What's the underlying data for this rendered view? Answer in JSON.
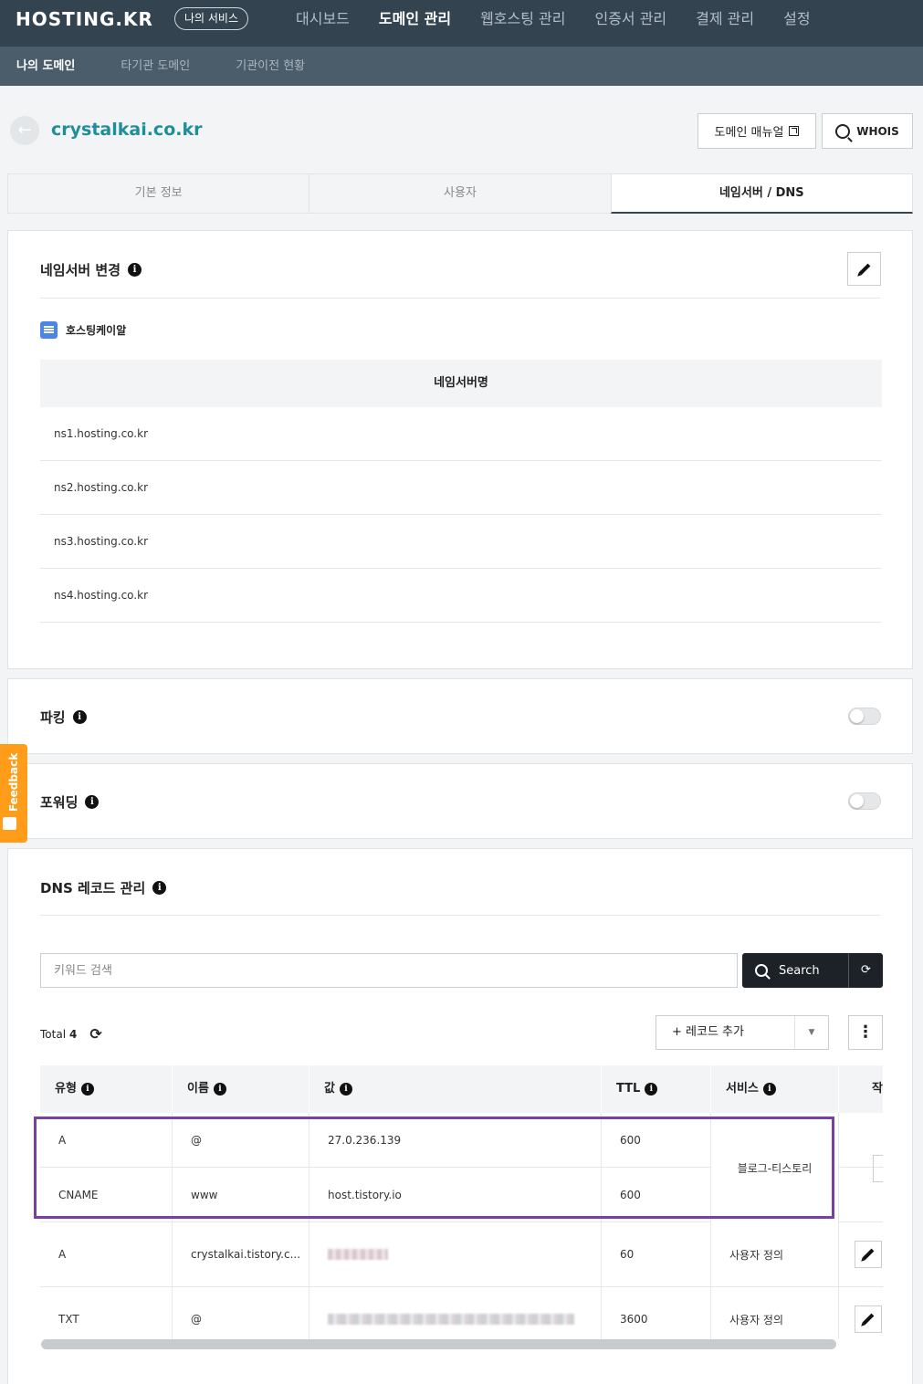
{
  "brand": {
    "logo": "HOSTING.KR",
    "my_service": "나의 서비스"
  },
  "main_nav": [
    "대시보드",
    "도메인 관리",
    "웹호스팅 관리",
    "인증서 관리",
    "결제 관리",
    "설정"
  ],
  "main_nav_active": "도메인 관리",
  "sub_nav": [
    "나의 도메인",
    "타기관 도메인",
    "기관이전 현황"
  ],
  "sub_nav_active": "나의 도메인",
  "header": {
    "domain": "crystalkai.co.kr",
    "manual_label": "도메인 매뉴얼",
    "whois_label": "WHOIS"
  },
  "tabs": [
    "기본 정보",
    "사용자",
    "네임서버 / DNS"
  ],
  "tab_active": "네임서버 / DNS",
  "nameserver": {
    "title": "네임서버 변경",
    "provider": "호스팅케이알",
    "column": "네임서버명",
    "servers": [
      "ns1.hosting.co.kr",
      "ns2.hosting.co.kr",
      "ns3.hosting.co.kr",
      "ns4.hosting.co.kr"
    ]
  },
  "parking": {
    "title": "파킹",
    "enabled": false
  },
  "forwarding": {
    "title": "포워딩",
    "enabled": false
  },
  "dns": {
    "title": "DNS 레코드 관리",
    "search_placeholder": "키워드 검색",
    "search_label": "Search",
    "total_label": "Total",
    "total_count": "4",
    "add_record_label": "+ 레코드 추가",
    "columns": {
      "type": "유형",
      "name": "이름",
      "value": "값",
      "ttl": "TTL",
      "service": "서비스",
      "action": "작"
    },
    "rows": [
      {
        "type": "A",
        "name": "@",
        "value": "27.0.236.139",
        "ttl": "600"
      },
      {
        "type": "CNAME",
        "name": "www",
        "value": "host.tistory.io",
        "ttl": "600"
      },
      {
        "type": "A",
        "name": "crystalkai.tistory.c...",
        "value": "",
        "ttl": "60",
        "service": "사용자 정의"
      },
      {
        "type": "TXT",
        "name": "@",
        "value": "",
        "ttl": "3600",
        "service": "사용자 정의"
      }
    ],
    "merged_service": "블로그-티스토리"
  },
  "feedback": {
    "label": "Feedback"
  },
  "colors": {
    "topbar": "#334350",
    "subbar": "#4b5d6b",
    "accent": "#1e8e9a",
    "highlight": "#7a3fa7",
    "feedback": "#ff9d1a"
  }
}
